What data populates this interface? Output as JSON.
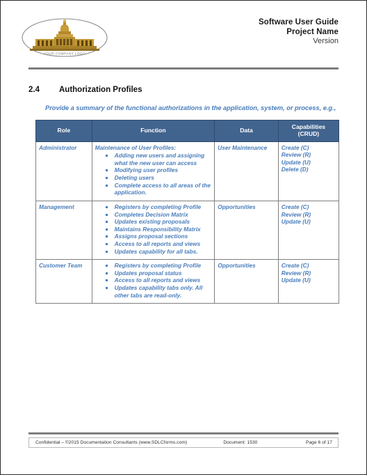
{
  "header": {
    "logo_alt": "YOUR COMPANY LOGO",
    "logo_caption": "YOUR COMPANY LOGO",
    "title_line1": "Software User Guide",
    "title_line2": "Project Name",
    "title_line3": "Version"
  },
  "section": {
    "number": "2.4",
    "title": "Authorization Profiles",
    "intro": "Provide a summary of the functional authorizations in the application, system, or process, e.g.,"
  },
  "table": {
    "columns": [
      "Role",
      "Function",
      "Data",
      "Capabilities (CRUD)"
    ],
    "column_capabilities_line1": "Capabilities",
    "column_capabilities_line2": "(CRUD)",
    "rows": [
      {
        "role": "Administrator",
        "function_title": "Maintenance of User Profiles:",
        "function_items": [
          "Adding new users and assigning what the new user can access",
          "Modifying user profiles",
          "Deleting users",
          "Complete access to all areas of the application."
        ],
        "data": "User Maintenance",
        "capabilities": [
          "Create (C)",
          "Review (R)",
          "Update (U)",
          "Delete (D)"
        ]
      },
      {
        "role": "Management",
        "function_title": "",
        "function_items": [
          "Registers by completing Profile",
          "Completes Decision Matrix",
          "Updates existing proposals",
          "Maintains Responsibility Matrix",
          "Assigns proposal sections",
          "Access to all reports and views",
          "Updates capability for all tabs."
        ],
        "data": "Opportunities",
        "capabilities": [
          "Create (C)",
          "Review (R)",
          "Update (U)"
        ]
      },
      {
        "role": "Customer Team",
        "function_title": "",
        "function_items": [
          "Registers by completing Profile",
          "Updates proposal status",
          "Access to all reports and views",
          "Updates capability tabs only. All other tabs are read-only."
        ],
        "data": "Opportunities",
        "capabilities": [
          "Create (C)",
          "Review (R)",
          "Update (U)"
        ]
      }
    ]
  },
  "footer": {
    "confidential": "Confidential – ©2015 Documentation Consultants (www.SDLCforms.com)",
    "document": "Document: 1530",
    "page": "Page 6 of 17"
  },
  "colors": {
    "table_header_bg": "#41648F",
    "body_text_blue": "#4A7EBB",
    "rule_gray": "#808080"
  }
}
